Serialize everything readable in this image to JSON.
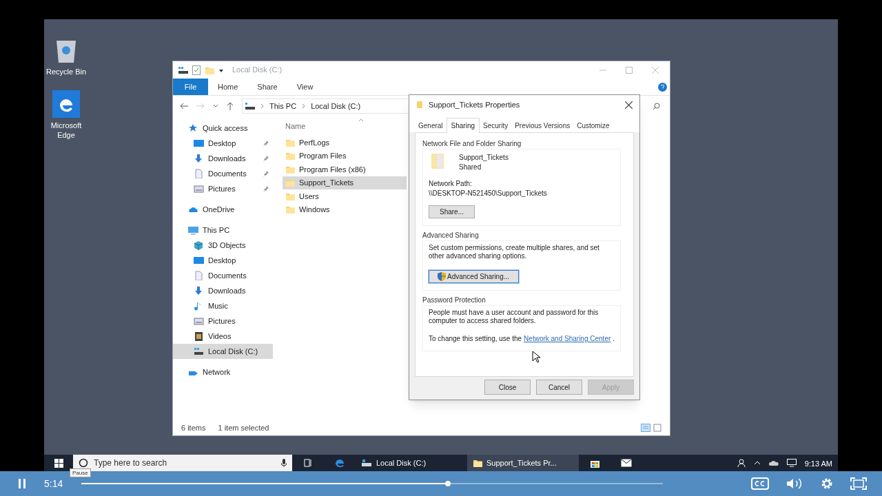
{
  "desktop_icons": [
    {
      "label": "Recycle Bin",
      "kind": "recycle"
    },
    {
      "label": "Microsoft Edge",
      "kind": "edge"
    }
  ],
  "explorer": {
    "title": "Local Disk (C:)",
    "ribbon_tabs": [
      {
        "label": "File",
        "kind": "file"
      },
      {
        "label": "Home",
        "kind": "tab"
      },
      {
        "label": "Share",
        "kind": "tab"
      },
      {
        "label": "View",
        "kind": "tab"
      }
    ],
    "breadcrumb": [
      "This PC",
      "Local Disk (C:)"
    ],
    "column": "Name",
    "nav": [
      {
        "label": "Quick access",
        "kind": "star",
        "selected": false,
        "children": [
          {
            "label": "Desktop",
            "kind": "desktop",
            "pinned": true,
            "selected": false
          },
          {
            "label": "Downloads",
            "kind": "download",
            "pinned": true,
            "selected": false
          },
          {
            "label": "Documents",
            "kind": "document",
            "pinned": true,
            "selected": false
          },
          {
            "label": "Pictures",
            "kind": "pictures",
            "pinned": true,
            "selected": false
          }
        ]
      },
      {
        "label": "OneDrive",
        "kind": "cloud",
        "selected": false
      },
      {
        "label": "This PC",
        "kind": "pc",
        "selected": false,
        "children": [
          {
            "label": "3D Objects",
            "kind": "cube",
            "selected": false
          },
          {
            "label": "Desktop",
            "kind": "desktop",
            "selected": false
          },
          {
            "label": "Documents",
            "kind": "document",
            "selected": false
          },
          {
            "label": "Downloads",
            "kind": "download",
            "selected": false
          },
          {
            "label": "Music",
            "kind": "music",
            "selected": false
          },
          {
            "label": "Pictures",
            "kind": "pictures",
            "selected": false
          },
          {
            "label": "Videos",
            "kind": "video",
            "selected": false
          },
          {
            "label": "Local Disk (C:)",
            "kind": "disk",
            "selected": true
          }
        ]
      },
      {
        "label": "Network",
        "kind": "network",
        "selected": false
      }
    ],
    "files": [
      {
        "name": "PerfLogs",
        "selected": false
      },
      {
        "name": "Program Files",
        "selected": false
      },
      {
        "name": "Program Files (x86)",
        "selected": false
      },
      {
        "name": "Support_Tickets",
        "selected": true
      },
      {
        "name": "Users",
        "selected": false
      },
      {
        "name": "Windows",
        "selected": false
      }
    ],
    "status": [
      "6 items",
      "1 item selected"
    ]
  },
  "dialog": {
    "title": "Support_Tickets Properties",
    "tabs": [
      {
        "label": "General",
        "selected": false
      },
      {
        "label": "Sharing",
        "selected": true
      },
      {
        "label": "Security",
        "selected": false
      },
      {
        "label": "Previous Versions",
        "selected": false
      },
      {
        "label": "Customize",
        "selected": false
      }
    ],
    "network_sharing": {
      "heading": "Network File and Folder Sharing",
      "name": "Support_Tickets",
      "state": "Shared",
      "path_label": "Network Path:",
      "path": "\\\\DESKTOP-N521450\\Support_Tickets",
      "button": "Share..."
    },
    "advanced_sharing": {
      "heading": "Advanced Sharing",
      "text": "Set custom permissions, create multiple shares, and set other advanced sharing options.",
      "button": "Advanced Sharing...",
      "focused": true
    },
    "password_protection": {
      "heading": "Password Protection",
      "text": "People must have a user account and password for this computer to access shared folders.",
      "change_text": "To change this setting, use the",
      "link": "Network and Sharing Center",
      "after_link": "."
    },
    "buttons": [
      {
        "label": "Close",
        "disabled": false
      },
      {
        "label": "Cancel",
        "disabled": false
      },
      {
        "label": "Apply",
        "disabled": true
      }
    ]
  },
  "taskbar": {
    "search": {
      "placeholder": "Type here to search"
    },
    "tasks": [
      {
        "label": "Local Disk (C:)",
        "active": false
      },
      {
        "label": "Support_Tickets Pr...",
        "active": true
      }
    ],
    "clock": "9:13 AM"
  },
  "player": {
    "tooltip": "Pause",
    "time": "5:14",
    "level": 0.63
  }
}
